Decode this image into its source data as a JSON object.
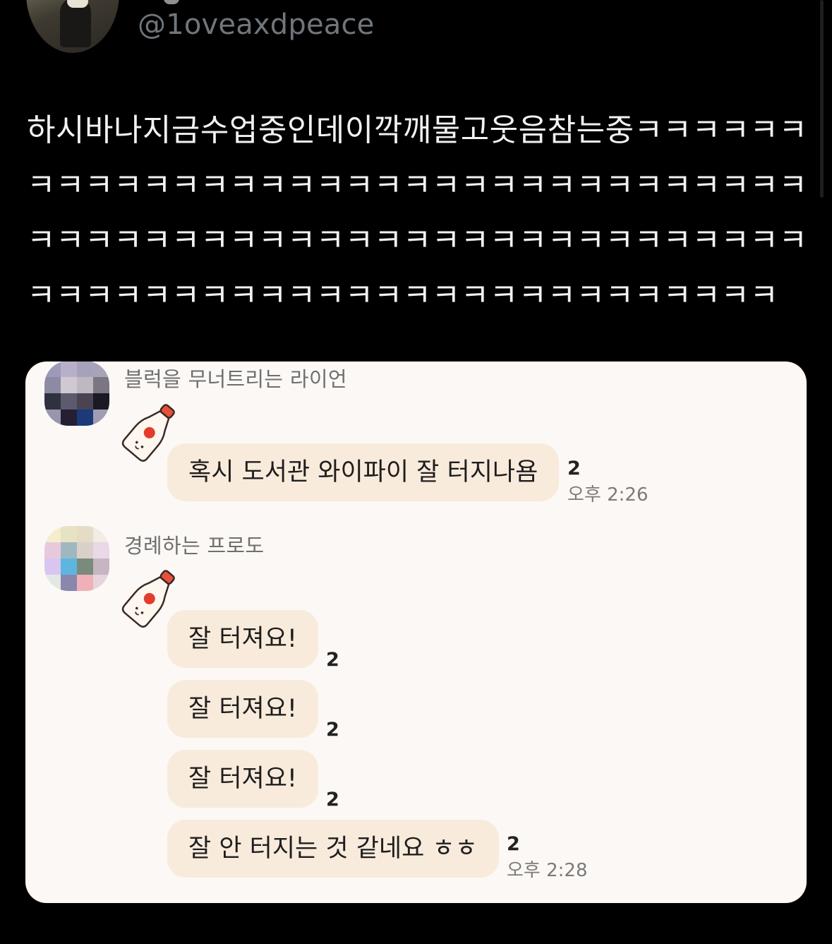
{
  "tweet": {
    "handle": "@1oveaxdpeace",
    "text": "하시바나지금수업중인데이깍깨물고웃음참는중ㅋㅋㅋㅋㅋㅋㅋㅋㅋㅋㅋㅋㅋㅋㅋㅋㅋㅋㅋㅋㅋㅋㅋㅋㅋㅋㅋㅋㅋㅋㅋㅋㅋㅋㅋㅋㅋㅋㅋㅋㅋㅋㅋㅋㅋㅋㅋㅋㅋㅋㅋㅋㅋㅋㅋㅋㅋㅋㅋㅋㅋㅋㅋㅋㅋㅋㅋㅋㅋㅋㅋㅋㅋㅋㅋㅋㅋㅋㅋㅋㅋㅋㅋㅋㅋㅋ"
  },
  "chat": {
    "messages": [
      {
        "sender": "블럭을 무너트리는 라이언",
        "bubbles": [
          {
            "text": "혹시 도서관 와이파이 잘 터지나욤",
            "unread": "2",
            "time": "오후 2:26"
          }
        ]
      },
      {
        "sender": "경례하는 프로도",
        "bubbles": [
          {
            "text": "잘 터져요!",
            "unread": "2"
          },
          {
            "text": "잘 터져요!",
            "unread": "2"
          },
          {
            "text": "잘 터져요!",
            "unread": "2"
          },
          {
            "text": "잘 안 터지는 것 같네요 ㅎㅎ",
            "unread": "2",
            "time": "오후 2:28"
          }
        ]
      }
    ]
  },
  "colors": {
    "background": "#000000",
    "handle": "#6f767c",
    "chat_background": "#fcf8f5",
    "bubble": "#f9ebdc"
  },
  "icons": [
    "profile-avatar-icon",
    "milk-bottle-sticker-icon",
    "pixelated-avatar-icon"
  ]
}
